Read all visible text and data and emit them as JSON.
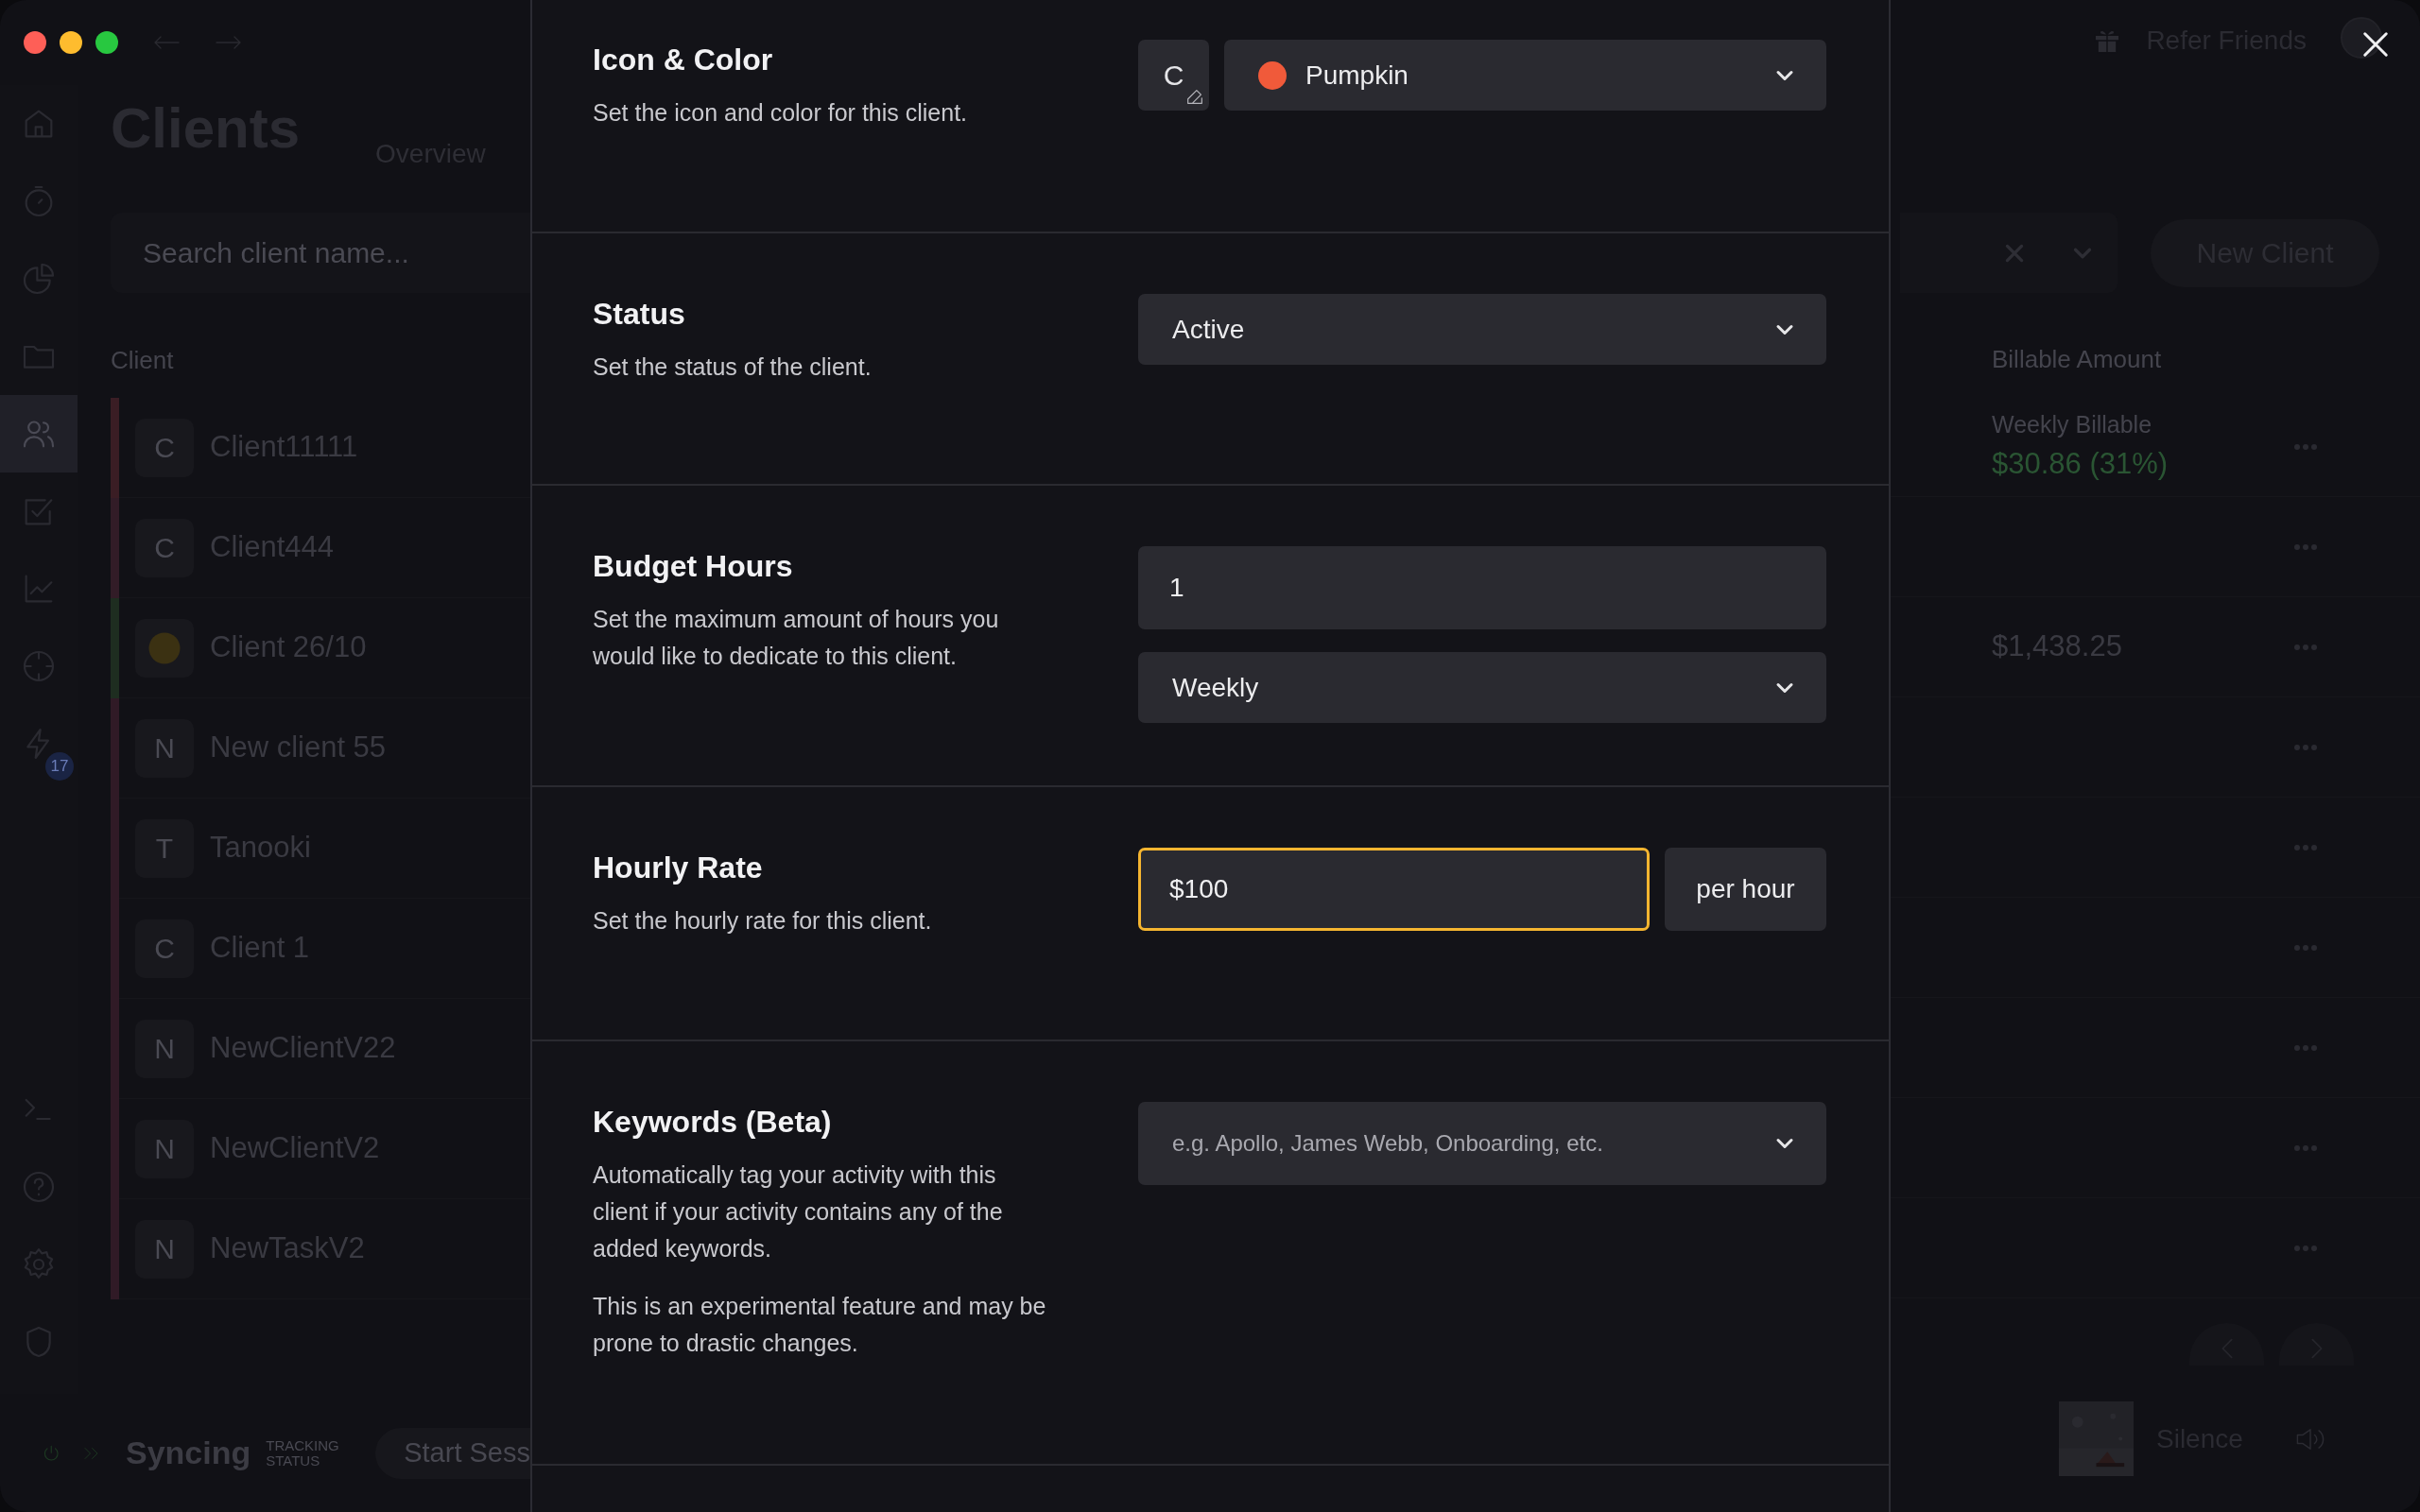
{
  "sidebar": {
    "items": [
      {
        "selected": false
      },
      {
        "selected": false
      },
      {
        "selected": false
      },
      {
        "selected": false
      },
      {
        "selected": true
      },
      {
        "selected": false
      },
      {
        "selected": false
      },
      {
        "selected": false
      },
      {
        "selected": false,
        "badge": "17"
      }
    ],
    "bottom_items": [
      {
        "selected": false
      },
      {
        "selected": false
      },
      {
        "selected": false
      },
      {
        "selected": false
      }
    ]
  },
  "top_bar": {
    "refer": "Refer Friends"
  },
  "page": {
    "title": "Clients",
    "tabs": [
      {
        "label": "Overview",
        "selected": false
      }
    ],
    "search": {
      "placeholder": "Search client name..."
    },
    "new_client": "New Client"
  },
  "table": {
    "columns": [
      "Client",
      "Billable Amount"
    ],
    "rows": [
      {
        "kind": "letter",
        "avatar": "C",
        "name": "Client11111",
        "color": "#3a1d24",
        "billable_label": "Weekly Billable",
        "billable": "$30.86 (31%)"
      },
      {
        "kind": "letter",
        "avatar": "C",
        "name": "Client444",
        "color": "#321c27"
      },
      {
        "kind": "emoji",
        "name": "Client 26/10",
        "color": "#1e2d20",
        "billable": "$1,438.25"
      },
      {
        "kind": "letter",
        "avatar": "N",
        "name": "New client 55",
        "color": "#301a26"
      },
      {
        "kind": "letter",
        "avatar": "T",
        "name": "Tanooki",
        "color": "#301a26"
      },
      {
        "kind": "letter",
        "avatar": "C",
        "name": "Client 1",
        "color": "#301a26"
      },
      {
        "kind": "letter",
        "avatar": "N",
        "name": "NewClientV22",
        "color": "#301a26"
      },
      {
        "kind": "letter",
        "avatar": "N",
        "name": "NewClientV2",
        "color": "#301a26"
      },
      {
        "kind": "letter",
        "avatar": "N",
        "name": "NewTaskV2",
        "color": "#301a26"
      }
    ]
  },
  "status_bar": {
    "state": "Syncing",
    "caption": "TRACKING STATUS",
    "start_button": "Start Sess",
    "now_playing": "Silence"
  },
  "modal": {
    "sections": [
      {
        "title": "Icon & Color",
        "description": [
          "Set the icon and color for this client."
        ],
        "controls": [
          [
            {
              "kind": "icon",
              "letter": "C"
            },
            {
              "kind": "select",
              "value": "Pumpkin",
              "color": "#f05a3a"
            }
          ]
        ]
      },
      {
        "title": "Status",
        "description": [
          "Set the status of the client."
        ],
        "controls": [
          [
            {
              "kind": "select",
              "value": "Active"
            }
          ]
        ]
      },
      {
        "title": "Budget Hours",
        "description": [
          "Set the maximum amount of hours you would like to dedicate to this client."
        ],
        "controls": [
          [
            {
              "kind": "input",
              "value": "1",
              "focused": false
            }
          ],
          [
            {
              "kind": "select",
              "value": "Weekly"
            }
          ]
        ]
      },
      {
        "title": "Hourly Rate",
        "description": [
          "Set the hourly rate for this client."
        ],
        "controls": [
          [
            {
              "kind": "input",
              "value": "$100",
              "focused": true
            },
            {
              "kind": "addon",
              "text": "per hour"
            }
          ]
        ]
      },
      {
        "title": "Keywords (Beta)",
        "description": [
          "Automatically tag your activity with this client if your activity contains any of the added keywords.",
          "This is an experimental feature and may be prone to drastic changes."
        ],
        "controls": [
          [
            {
              "kind": "select",
              "placeholder": "e.g. Apollo, James Webb, Onboarding, etc."
            }
          ]
        ]
      }
    ]
  }
}
